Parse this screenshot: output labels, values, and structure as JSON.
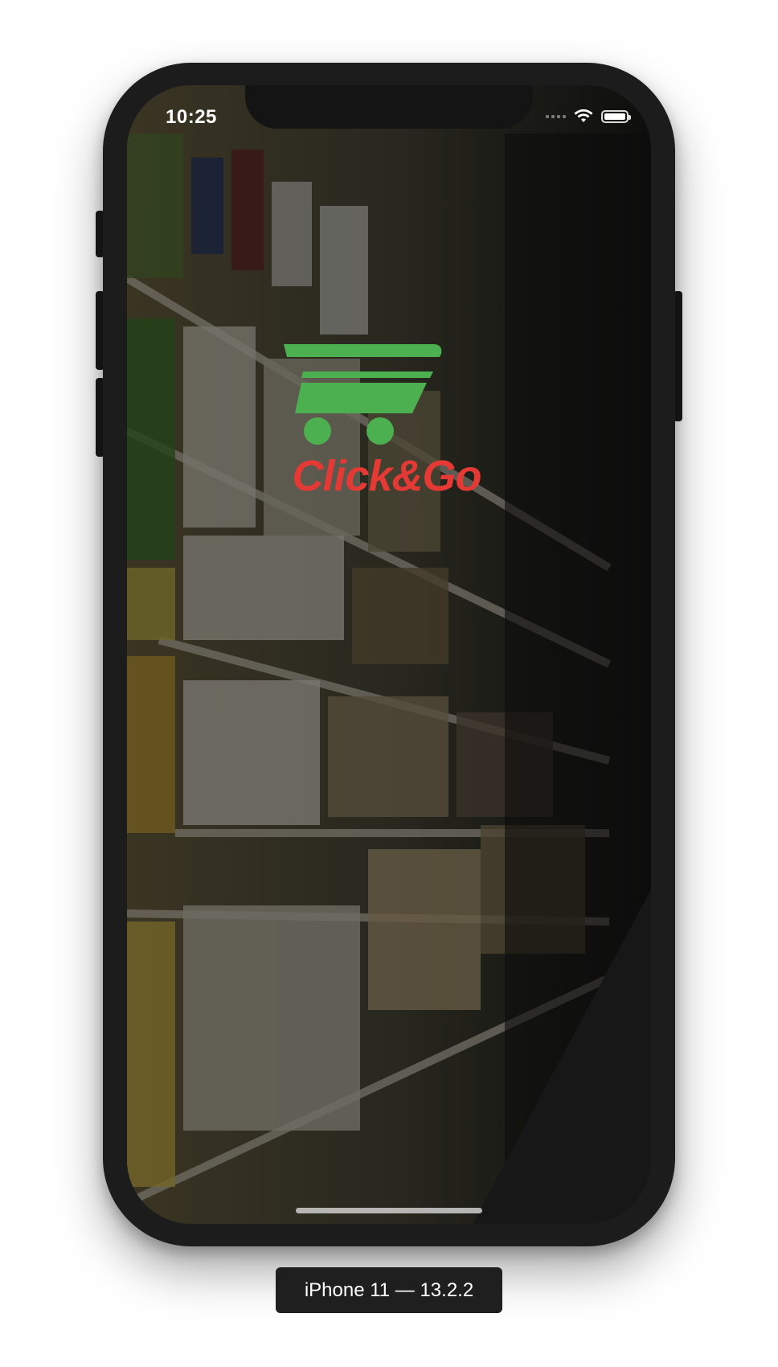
{
  "status_bar": {
    "time": "10:25",
    "battery_level": 1.0
  },
  "splash": {
    "logo_text": "Click&Go",
    "logo_cart_color": "#4caf50",
    "logo_text_color": "#e53935"
  },
  "simulator": {
    "device_label": "iPhone 11 — 13.2.2"
  }
}
